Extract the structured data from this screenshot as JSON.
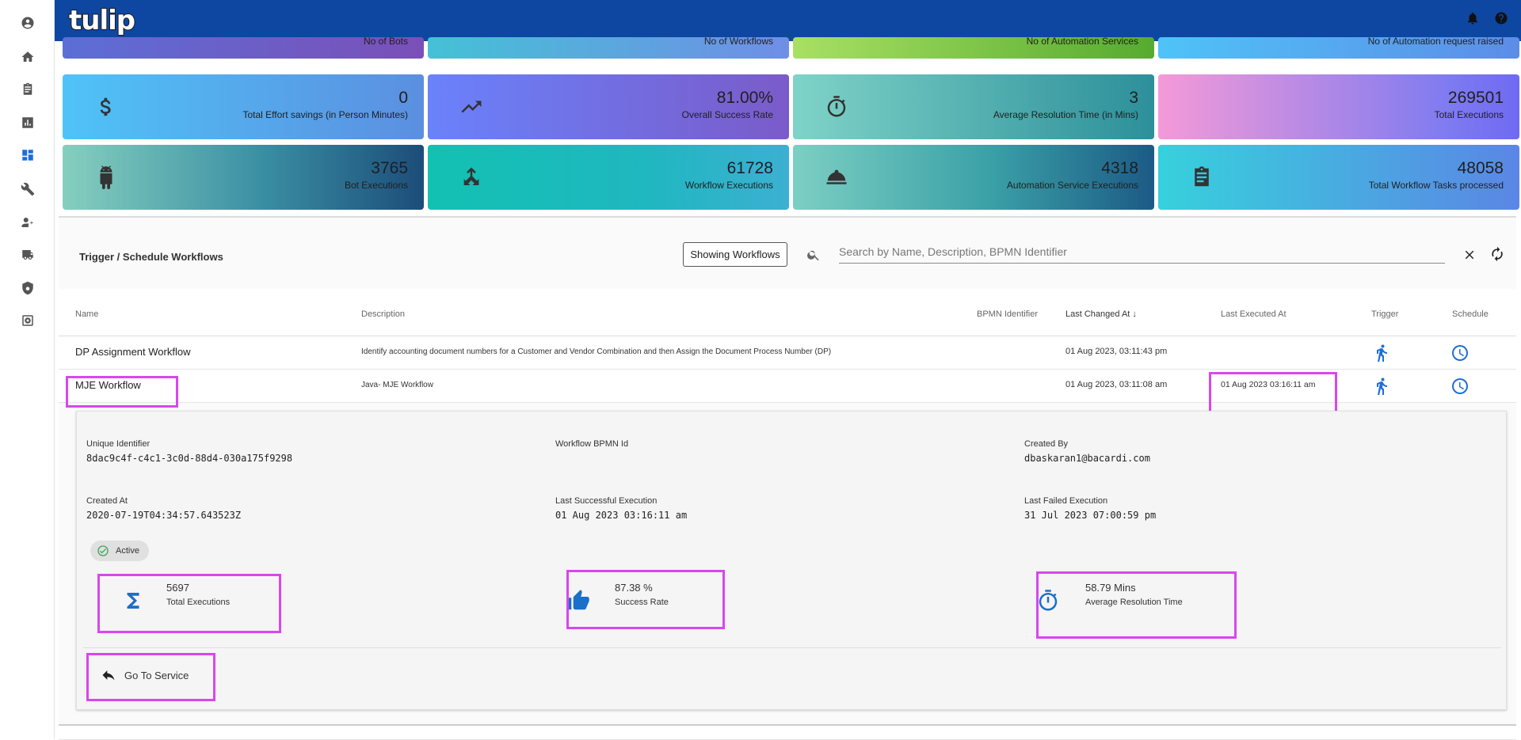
{
  "app": {
    "logo_text": "tulip"
  },
  "colors": {
    "topbar": "#0d47a1",
    "accent": "#1e6ed8",
    "highlight": "#d946ef"
  },
  "sidebar": {
    "items": [
      {
        "icon": "account-icon"
      },
      {
        "icon": "home-icon"
      },
      {
        "icon": "clipboard-icon"
      },
      {
        "icon": "report-icon"
      },
      {
        "icon": "dashboard-icon"
      },
      {
        "icon": "wrench-icon"
      },
      {
        "icon": "user-settings-icon"
      },
      {
        "icon": "truck-icon"
      },
      {
        "icon": "shield-gear-icon"
      },
      {
        "icon": "process-icon"
      }
    ]
  },
  "cards_top": [
    {
      "label": "No of Bots"
    },
    {
      "label": "No of Workflows"
    },
    {
      "label": "No of Automation Services"
    },
    {
      "label": "No of Automation request raised"
    }
  ],
  "cards": [
    {
      "value": "0",
      "label": "Total Effort savings (in Person Minutes)",
      "icon": "dollar-icon"
    },
    {
      "value": "81.00%",
      "label": "Overall Success Rate",
      "icon": "trending-up-icon"
    },
    {
      "value": "3",
      "label": "Average Resolution Time (in Mins)",
      "icon": "timer-icon"
    },
    {
      "value": "269501",
      "label": "Total Executions",
      "icon": "none"
    },
    {
      "value": "3765",
      "label": "Bot Executions",
      "icon": "android-icon"
    },
    {
      "value": "61728",
      "label": "Workflow Executions",
      "icon": "workflow-icon"
    },
    {
      "value": "4318",
      "label": "Automation Service Executions",
      "icon": "service-bell-icon"
    },
    {
      "value": "48058",
      "label": "Total Workflow Tasks processed",
      "icon": "assignment-icon"
    }
  ],
  "panel": {
    "title": "Trigger / Schedule Workflows",
    "filter_button": "Showing Workflows",
    "search_placeholder": "Search by Name, Description, BPMN Identifier"
  },
  "table": {
    "headers": {
      "name": "Name",
      "description": "Description",
      "bpmn": "BPMN Identifier",
      "last_changed": "Last Changed At",
      "last_executed": "Last Executed At",
      "trigger": "Trigger",
      "schedule": "Schedule"
    },
    "rows": [
      {
        "name": "DP Assignment Workflow",
        "description": "Identify accounting document numbers for a Customer and Vendor Combination and then Assign the Document Process Number (DP)",
        "bpmn": "",
        "last_changed": "01 Aug 2023, 03:11:43 pm",
        "last_executed": ""
      },
      {
        "name": "MJE Workflow",
        "description": "Java- MJE Workflow",
        "bpmn": "",
        "last_changed": "01 Aug 2023, 03:11:08 am",
        "last_executed": "01 Aug 2023 03:16:11 am"
      }
    ]
  },
  "detail": {
    "unique_identifier_label": "Unique Identifier",
    "unique_identifier": "8dac9c4f-c4c1-3c0d-88d4-030a175f9298",
    "bpmn_id_label": "Workflow BPMN Id",
    "bpmn_id": "",
    "created_by_label": "Created By",
    "created_by": "dbaskaran1@bacardi.com",
    "created_at_label": "Created At",
    "created_at": "2020-07-19T04:34:57.643523Z",
    "last_success_label": "Last Successful Execution",
    "last_success": "01 Aug 2023 03:16:11 am",
    "last_failed_label": "Last Failed Execution",
    "last_failed": "31 Jul 2023 07:00:59 pm",
    "status": "Active",
    "stats": [
      {
        "value": "5697",
        "label": "Total Executions",
        "icon": "sigma-icon"
      },
      {
        "value": "87.38 %",
        "label": "Success Rate",
        "icon": "thumbs-up-icon"
      },
      {
        "value": "58.79 Mins",
        "label": "Average Resolution Time",
        "icon": "timer-icon"
      }
    ],
    "go_to_service": "Go To Service"
  }
}
